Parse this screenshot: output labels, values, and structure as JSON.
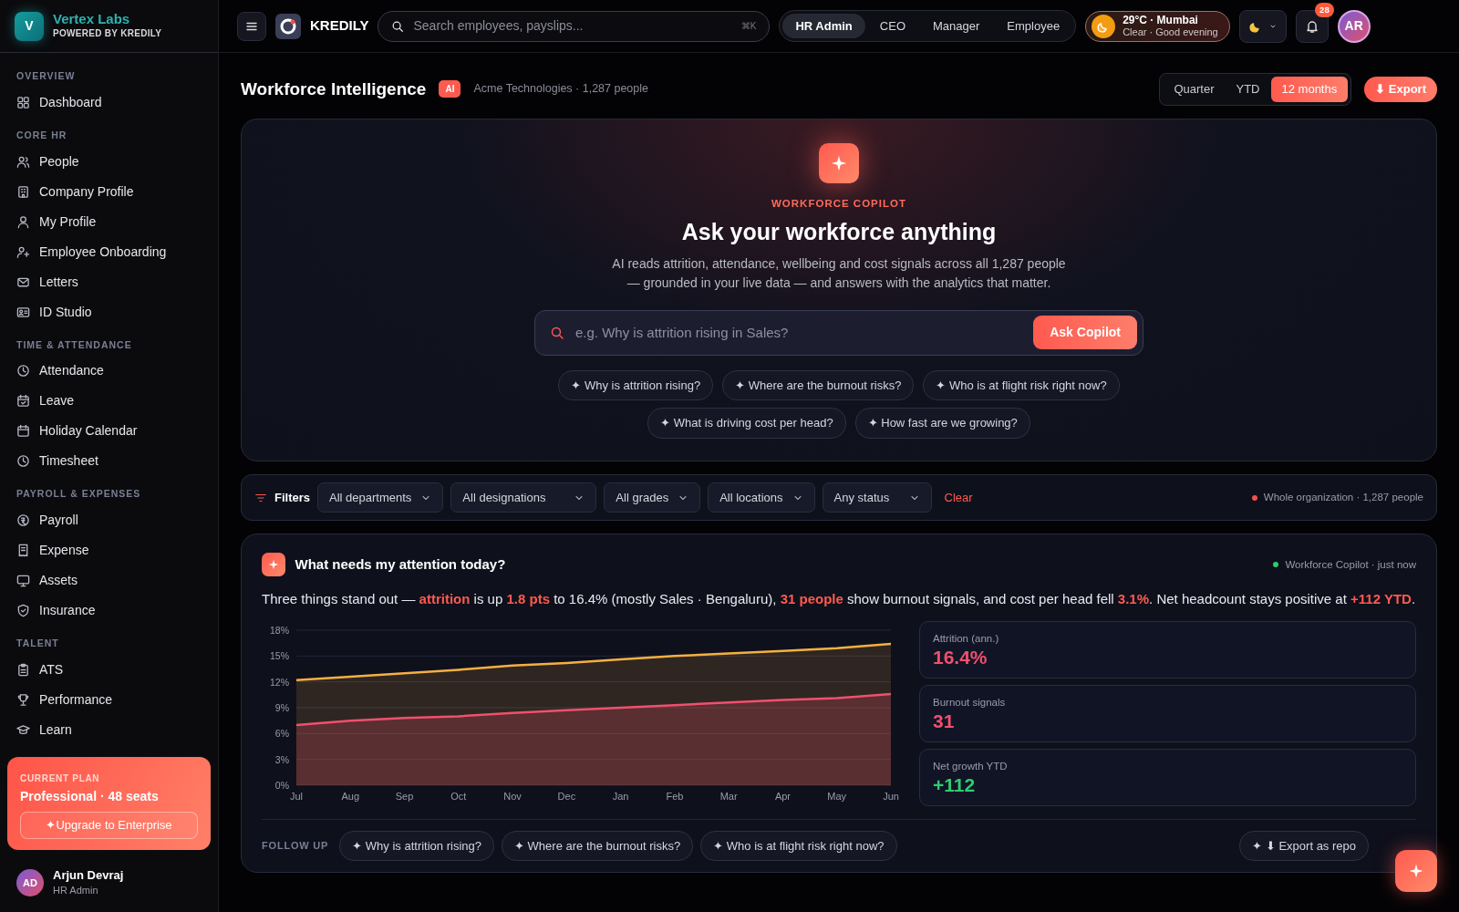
{
  "brand": {
    "initial": "V",
    "name": "Vertex Labs",
    "tagline": "POWERED BY KREDILY"
  },
  "sidebar": {
    "sections": [
      {
        "title": "OVERVIEW",
        "items": [
          {
            "label": "Dashboard"
          }
        ]
      },
      {
        "title": "CORE HR",
        "items": [
          {
            "label": "People"
          },
          {
            "label": "Company Profile"
          },
          {
            "label": "My Profile"
          },
          {
            "label": "Employee Onboarding"
          },
          {
            "label": "Letters"
          },
          {
            "label": "ID Studio"
          }
        ]
      },
      {
        "title": "TIME & ATTENDANCE",
        "items": [
          {
            "label": "Attendance"
          },
          {
            "label": "Leave"
          },
          {
            "label": "Holiday Calendar"
          },
          {
            "label": "Timesheet"
          }
        ]
      },
      {
        "title": "PAYROLL & EXPENSES",
        "items": [
          {
            "label": "Payroll"
          },
          {
            "label": "Expense"
          },
          {
            "label": "Assets"
          },
          {
            "label": "Insurance"
          }
        ]
      },
      {
        "title": "TALENT",
        "items": [
          {
            "label": "ATS"
          },
          {
            "label": "Performance"
          },
          {
            "label": "Learn"
          }
        ]
      }
    ],
    "plan": {
      "caption": "CURRENT PLAN",
      "name": "Professional · 48 seats",
      "button": "✦Upgrade to Enterprise"
    },
    "user": {
      "initials": "AD",
      "name": "Arjun Devraj",
      "role": "HR Admin"
    }
  },
  "topbar": {
    "logo": "KREDILY",
    "search": {
      "placeholder": "Search employees, payslips...",
      "shortcut": "⌘K"
    },
    "roles": [
      {
        "label": "HR Admin",
        "selected": true
      },
      {
        "label": "CEO",
        "selected": false
      },
      {
        "label": "Manager",
        "selected": false
      },
      {
        "label": "Employee",
        "selected": false
      }
    ],
    "weather": {
      "temp": "29°C · Mumbai",
      "desc": "Clear · Good evening"
    },
    "notifications": "28",
    "avatar": "AR"
  },
  "header": {
    "title": "Workforce Intelligence",
    "badge": "AI",
    "subtitle": "Acme Technologies · 1,287 people",
    "periods": [
      {
        "label": "Quarter",
        "selected": false
      },
      {
        "label": "YTD",
        "selected": false
      },
      {
        "label": "12 months",
        "selected": true
      }
    ],
    "export": "⬇ Export"
  },
  "copilot": {
    "eyebrow": "WORKFORCE COPILOT",
    "title": "Ask your workforce anything",
    "description": "AI reads attrition, attendance, wellbeing and cost signals across all 1,287 people — grounded in your live data — and answers with the analytics that matter.",
    "placeholder": "e.g. Why is attrition rising in Sales?",
    "button": "Ask Copilot",
    "suggestions": [
      "✦ Why is attrition rising?",
      "✦ Where are the burnout risks?",
      "✦ Who is at flight risk right now?",
      "✦ What is driving cost per head?",
      "✦ How fast are we growing?"
    ]
  },
  "filters": {
    "label": "Filters",
    "dropdowns": [
      "All departments",
      "All designations",
      "All grades",
      "All locations",
      "Any status"
    ],
    "clear": "Clear",
    "scope": "Whole organization · 1,287 people"
  },
  "attention": {
    "title": "What needs my attention today?",
    "source": "Workforce Copilot · just now",
    "summary": "Three things stand out — **attrition** is up **1.8 pts** to 16.4% (mostly Sales · Bengaluru), **31 people** show burnout signals, and cost per head fell **3.1%**. Net headcount stays positive at **+112 YTD**.",
    "chart_data": {
      "type": "area",
      "categories": [
        "Jul",
        "Aug",
        "Sep",
        "Oct",
        "Nov",
        "Dec",
        "Jan",
        "Feb",
        "Mar",
        "Apr",
        "May",
        "Jun"
      ],
      "series": [
        {
          "color": "#f5b041",
          "values": [
            12.2,
            12.6,
            13.0,
            13.4,
            13.9,
            14.2,
            14.6,
            15.0,
            15.3,
            15.6,
            15.9,
            16.4
          ]
        },
        {
          "color": "#f0506e",
          "values": [
            7.0,
            7.5,
            7.8,
            8.0,
            8.4,
            8.7,
            9.0,
            9.3,
            9.6,
            9.9,
            10.1,
            10.6
          ]
        }
      ],
      "ylim": [
        0,
        18
      ],
      "grid": true,
      "yticks": [
        {
          "value": 0,
          "label": "0%"
        },
        {
          "value": 3,
          "label": "3%"
        },
        {
          "value": 6,
          "label": "6%"
        },
        {
          "value": 9,
          "label": "9%"
        },
        {
          "value": 12,
          "label": "12%"
        },
        {
          "value": 15,
          "label": "15%"
        },
        {
          "value": 18,
          "label": "18%"
        }
      ]
    },
    "stats": [
      {
        "label": "Attrition (ann.)",
        "value": "16.4%",
        "color": "#f0506e"
      },
      {
        "label": "Burnout signals",
        "value": "31",
        "color": "#f0506e"
      },
      {
        "label": "Net growth YTD",
        "value": "+112",
        "color": "#2ecc71"
      }
    ],
    "followup_label": "FOLLOW UP",
    "followups": [
      "✦ Why is attrition rising?",
      "✦ Where are the burnout risks?",
      "✦ Who is at flight risk right now?"
    ],
    "export_report": "✦ ⬇ Export as repo"
  }
}
